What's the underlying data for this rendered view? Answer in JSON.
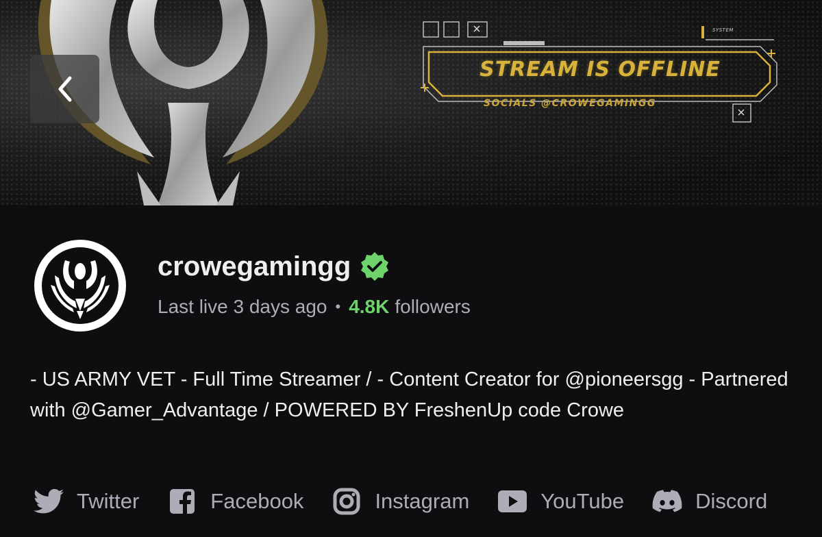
{
  "banner": {
    "offline_text": "STREAM IS OFFLINE",
    "socials_text": "SOCIALS @CROWEGAMINGG",
    "system_label": "SYSTEM"
  },
  "profile": {
    "username": "crowegamingg",
    "verified_icon": "verified-badge-icon",
    "last_live": "Last live 3 days ago",
    "separator": "•",
    "follower_count": "4.8K",
    "followers_label": "followers",
    "bio": "- US ARMY VET - Full Time Streamer / - Content Creator for @pioneersgg - Partnered with @Gamer_Advantage / POWERED BY FreshenUp code Crowe"
  },
  "socials": [
    {
      "label": "Twitter",
      "icon": "twitter-icon"
    },
    {
      "label": "Facebook",
      "icon": "facebook-icon"
    },
    {
      "label": "Instagram",
      "icon": "instagram-icon"
    },
    {
      "label": "YouTube",
      "icon": "youtube-icon"
    },
    {
      "label": "Discord",
      "icon": "discord-icon"
    }
  ],
  "colors": {
    "accent_green": "#6fd36b",
    "muted_text": "#adadb8",
    "offline_gold": "#d8b23a",
    "background": "#0e0e10"
  }
}
